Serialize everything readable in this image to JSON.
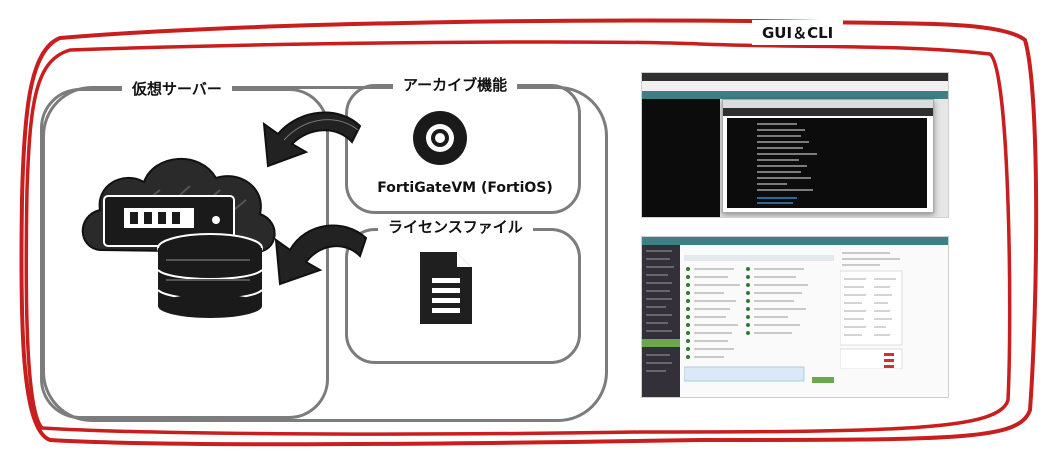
{
  "diagram": {
    "gui_cli_label": "GUI＆CLI",
    "virtual_server_label": "仮想サーバー",
    "archive_label": "アーカイブ機能",
    "archive_product": "FortiGateVM (FortiOS)",
    "license_label": "ライセンスファイル"
  },
  "colors": {
    "outer_red": "#c81e1e",
    "inner_gray": "#7c7c7c",
    "cli_bg": "#0c0c0c",
    "app_header": "#3e7f86",
    "sidebar": "#34303a"
  },
  "icons": {
    "server": "cloud-server-icon",
    "archive": "disc-icon",
    "license": "document-icon",
    "arrow": "curved-arrow-icon"
  }
}
